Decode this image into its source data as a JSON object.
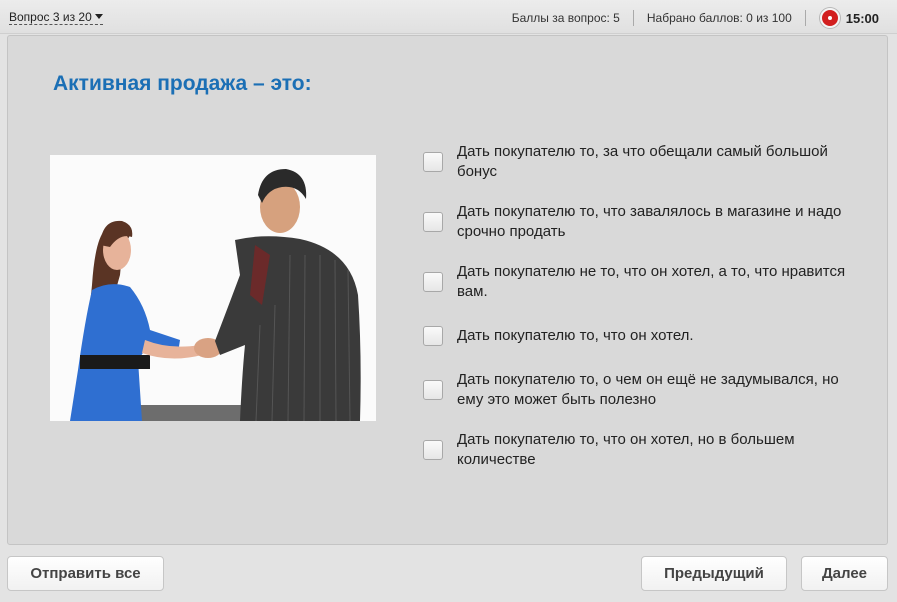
{
  "header": {
    "question_nav": "Вопрос 3 из 20",
    "points_per_question": "Баллы за вопрос: 5",
    "points_earned": "Набрано баллов: 0 из 100",
    "timer": "15:00"
  },
  "question": {
    "title": "Активная продажа – это:",
    "options": [
      "Дать покупателю то, за что обещали самый большой бонус",
      "Дать покупателю то, что завалялось в магазине и надо срочно продать",
      "Дать покупателю не то,  что он хотел, а то, что нравится вам.",
      "Дать покупателю то, что он хотел.",
      "Дать покупателю то, о чем он ещё не задумывался, но ему это может быть полезно",
      "Дать покупателю то, что он хотел, но в большем количестве"
    ]
  },
  "footer": {
    "submit_all": "Отправить все",
    "previous": "Предыдущий",
    "next": "Далее"
  },
  "colors": {
    "title": "#1b6fb5",
    "timer": "#d21f1f"
  }
}
